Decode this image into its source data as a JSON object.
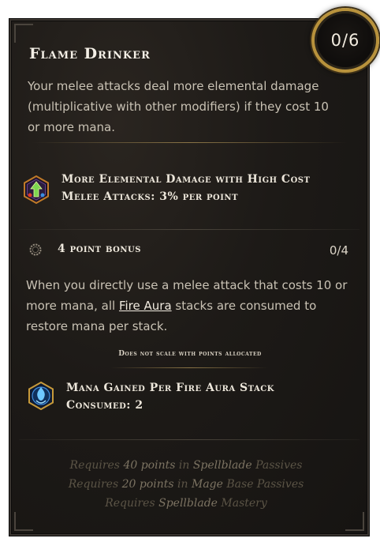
{
  "node": {
    "title": "Flame Drinker",
    "points": "0/6",
    "description": "Your melee attacks deal more elemental damage (multiplicative with other modifiers) if they cost 10 or more mana."
  },
  "stat": {
    "line1": "More Elemental Damage with High Cost",
    "line2": "Melee Attacks: 3% per point"
  },
  "bonus": {
    "title": "4 point bonus",
    "count": "0/4",
    "desc_before": "When you directly use a melee attack that costs 10 or more mana, all ",
    "link": "Fire Aura",
    "desc_after": " stacks are consumed to restore mana per stack.",
    "scale_note": "Does not scale with points allocated",
    "stat_line1": "Mana Gained Per Fire Aura Stack",
    "stat_line2": "Consumed: 2"
  },
  "requirements": [
    {
      "w1": "Requires",
      "w2": "40 points",
      "w3": "in",
      "w4": "Spellblade",
      "w5": "Passives"
    },
    {
      "w1": "Requires",
      "w2": "20 points",
      "w3": "in",
      "w4": "Mage",
      "w5": "Base Passives"
    },
    {
      "w1": "Requires",
      "w2": "Spellblade",
      "w3": "Mastery"
    }
  ],
  "icons": {
    "stat_icon": "elemental-arrow-hex-icon",
    "bonus_icon": "gear-ring-icon",
    "bonus_stat_icon": "blue-flame-aura-icon"
  }
}
